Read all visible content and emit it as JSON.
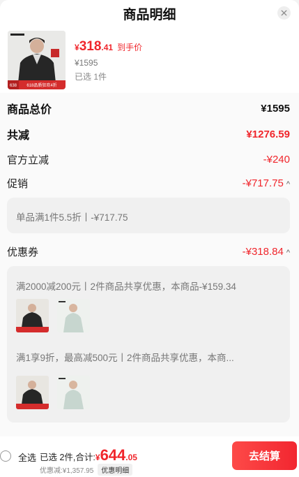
{
  "sheet": {
    "title": "商品明细"
  },
  "product": {
    "price_currency": "¥",
    "price_int": "318",
    "price_dec": ".41",
    "price_tag": "到手价",
    "original_price": "¥1595",
    "selected": "已选 1件",
    "promo_banner": "618品质狂欢4折",
    "banner_left": "638"
  },
  "rows": {
    "total_label": "商品总价",
    "total_value": "¥1595",
    "reduce_label": "共减",
    "reduce_value": "¥1276.59",
    "official_label": "官方立减",
    "official_value": "-¥240",
    "promo_label": "促销",
    "promo_value": "-¥717.75",
    "coupon_label": "优惠券",
    "coupon_value": "-¥318.84",
    "chevron": "^"
  },
  "promo_box": {
    "text": "单品满1件5.5折丨-¥717.75"
  },
  "coupon_box": {
    "line1": "满2000减200元丨2件商品共享优惠，本商品-¥159.34",
    "line2": "满1享9折，最高减500元丨2件商品共享优惠，本商..."
  },
  "footer": {
    "select_all": "全选",
    "selected_text": "已选 2件,合计:",
    "total_currency": "¥",
    "total_int": "644",
    "total_dec": ".05",
    "discount_text": "优惠减:¥1,357.95",
    "detail_chip": "优惠明细",
    "checkout": "去结算"
  },
  "colors": {
    "accent": "#f0262c",
    "button": "#f22630"
  }
}
